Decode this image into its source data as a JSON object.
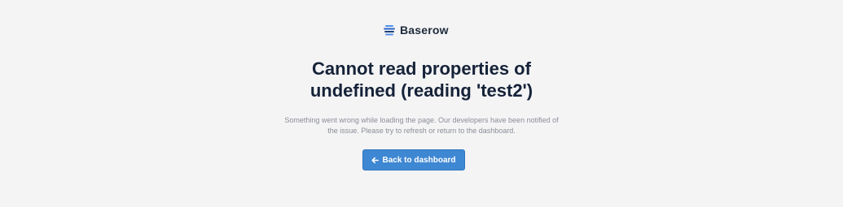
{
  "brand": {
    "name": "Baserow"
  },
  "error": {
    "title_line1": "Cannot read properties of",
    "title_line2": "undefined (reading 'test2')",
    "message_line1": "Something went wrong while loading the page. Our developers have been notified of",
    "message_line2": "the issue. Please try to refresh or return to the dashboard."
  },
  "actions": {
    "back_label": "Back to dashboard",
    "back_icon": "arrow-left-icon"
  },
  "colors": {
    "background": "#f4f4f5",
    "primary": "#3e87d3",
    "title": "#152238",
    "muted_text": "#8a8e96"
  }
}
